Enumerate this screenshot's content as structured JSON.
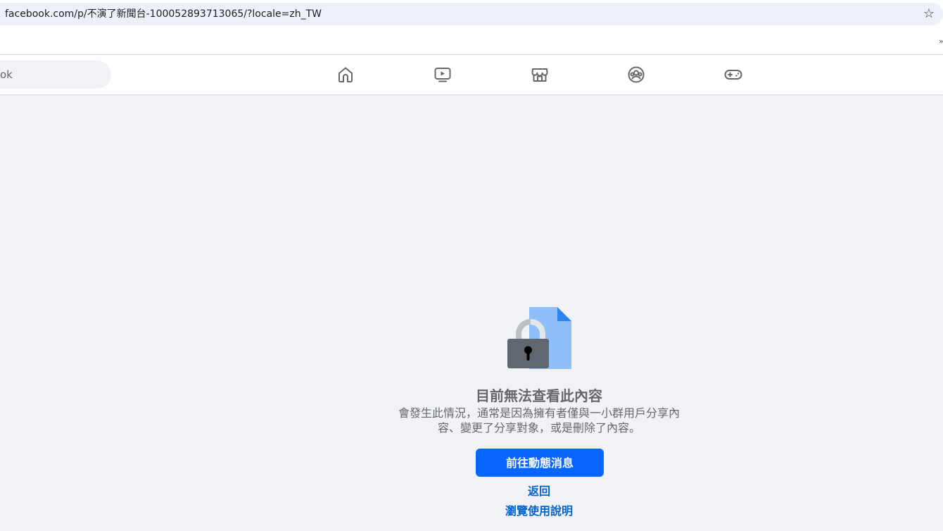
{
  "browser": {
    "url": "facebook.com/p/不演了新聞台-100052893713065/?locale=zh_TW",
    "bookmark_icon": "star-outline-icon",
    "bookmarks_overflow": "»"
  },
  "nav": {
    "search_text": "ok",
    "icons": [
      "home-icon",
      "video-icon",
      "marketplace-icon",
      "groups-icon",
      "gaming-icon"
    ]
  },
  "colors": {
    "page_bg": "#f0f2f5",
    "primary": "#0866ff",
    "link": "#0064d1",
    "muted_text": "#65676b"
  },
  "content": {
    "illustration": "locked-document-icon",
    "title": "目前無法查看此內容",
    "body_line1": "會發生此情況，通常是因為擁有者僅與一小群用戶分享內",
    "body_line2": "容、變更了分享對象，或是刪除了內容。",
    "primary_button": "前往動態消息",
    "back_link": "返回",
    "help_link": "瀏覽使用說明"
  }
}
